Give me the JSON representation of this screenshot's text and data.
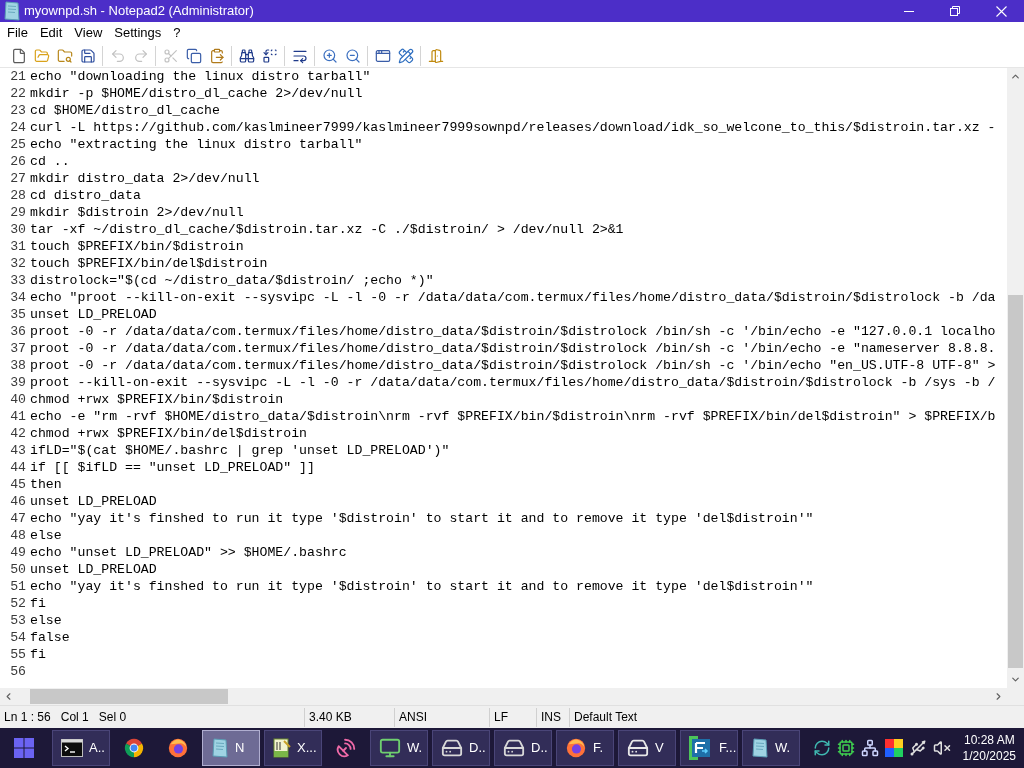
{
  "window": {
    "title": "myownpd.sh - Notepad2 (Administrator)"
  },
  "menu": [
    "File",
    "Edit",
    "View",
    "Settings",
    "?"
  ],
  "toolbar": [
    [
      {
        "disabled": false
      },
      {
        "disabled": false
      },
      {
        "disabled": false
      },
      {
        "disabled": false
      }
    ],
    [
      {
        "disabled": true
      },
      {
        "disabled": true
      }
    ],
    [
      {
        "disabled": true
      },
      {
        "disabled": false
      },
      {
        "disabled": false
      }
    ],
    [
      {
        "disabled": false
      },
      {
        "disabled": false
      }
    ],
    [
      {
        "disabled": false
      }
    ],
    [
      {
        "disabled": false
      },
      {
        "disabled": false
      }
    ],
    [
      {
        "disabled": false
      },
      {
        "disabled": false
      }
    ],
    [
      {
        "disabled": false
      }
    ]
  ],
  "editor": {
    "lines": [
      {
        "number": "21",
        "text": "echo \"downloading the linux distro tarball\""
      },
      {
        "number": "22",
        "text": "mkdir -p $HOME/distro_dl_cache 2>/dev/null"
      },
      {
        "number": "23",
        "text": "cd $HOME/distro_dl_cache"
      },
      {
        "number": "24",
        "text": "curl -L https://github.com/kaslmineer7999/kaslmineer7999sownpd/releases/download/idk_so_welcone_to_this/$distroin.tar.xz -"
      },
      {
        "number": "25",
        "text": "echo \"extracting the linux distro tarball\""
      },
      {
        "number": "26",
        "text": "cd .."
      },
      {
        "number": "27",
        "text": "mkdir distro_data 2>/dev/null"
      },
      {
        "number": "28",
        "text": "cd distro_data"
      },
      {
        "number": "29",
        "text": "mkdir $distroin 2>/dev/null"
      },
      {
        "number": "30",
        "text": "tar -xf ~/distro_dl_cache/$distroin.tar.xz -C ./$distroin/ > /dev/null 2>&1"
      },
      {
        "number": "31",
        "text": "touch $PREFIX/bin/$distroin"
      },
      {
        "number": "32",
        "text": "touch $PREFIX/bin/del$distroin"
      },
      {
        "number": "33",
        "text": "distrolock=\"$(cd ~/distro_data/$distroin/ ;echo *)\""
      },
      {
        "number": "34",
        "text": "echo \"proot --kill-on-exit --sysvipc -L -l -0 -r /data/data/com.termux/files/home/distro_data/$distroin/$distrolock -b /da"
      },
      {
        "number": "35",
        "text": "unset LD_PRELOAD"
      },
      {
        "number": "36",
        "text": "proot -0 -r /data/data/com.termux/files/home/distro_data/$distroin/$distrolock /bin/sh -c '/bin/echo -e \"127.0.0.1 localho"
      },
      {
        "number": "37",
        "text": "proot -0 -r /data/data/com.termux/files/home/distro_data/$distroin/$distrolock /bin/sh -c '/bin/echo -e \"nameserver 8.8.8."
      },
      {
        "number": "38",
        "text": "proot -0 -r /data/data/com.termux/files/home/distro_data/$distroin/$distrolock /bin/sh -c '/bin/echo \"en_US.UTF-8 UTF-8\" >"
      },
      {
        "number": "39",
        "text": "proot --kill-on-exit --sysvipc -L -l -0 -r /data/data/com.termux/files/home/distro_data/$distroin/$distrolock -b /sys -b /"
      },
      {
        "number": "40",
        "text": "chmod +rwx $PREFIX/bin/$distroin"
      },
      {
        "number": "41",
        "text": "echo -e \"rm -rvf $HOME/distro_data/$distroin\\nrm -rvf $PREFIX/bin/$distroin\\nrm -rvf $PREFIX/bin/del$distroin\" > $PREFIX/b"
      },
      {
        "number": "42",
        "text": "chmod +rwx $PREFIX/bin/del$distroin"
      },
      {
        "number": "43",
        "text": "ifLD=\"$(cat $HOME/.bashrc | grep 'unset LD_PRELOAD')\""
      },
      {
        "number": "44",
        "text": "if [[ $ifLD == \"unset LD_PRELOAD\" ]]"
      },
      {
        "number": "45",
        "text": "then"
      },
      {
        "number": "46",
        "text": "unset LD_PRELOAD"
      },
      {
        "number": "47",
        "text": "echo \"yay it's finshed to run it type '$distroin' to start it and to remove it type 'del$distroin'\""
      },
      {
        "number": "48",
        "text": "else"
      },
      {
        "number": "49",
        "text": "echo \"unset LD_PRELOAD\" >> $HOME/.bashrc"
      },
      {
        "number": "50",
        "text": "unset LD_PRELOAD"
      },
      {
        "number": "51",
        "text": "echo \"yay it's finshed to run it type '$distroin' to start it and to remove it type 'del$distroin'\""
      },
      {
        "number": "52",
        "text": "fi"
      },
      {
        "number": "53",
        "text": "else"
      },
      {
        "number": "54",
        "text": "false"
      },
      {
        "number": "55",
        "text": "fi"
      },
      {
        "number": "56"
      }
    ]
  },
  "status_bar": {
    "panes": [
      {
        "texts": [
          "Ln 1 : 56",
          "Col 1",
          "Sel 0"
        ]
      },
      {
        "texts": [
          "3.40 KB"
        ]
      },
      {
        "texts": [
          "ANSI"
        ]
      },
      {
        "texts": [
          "LF"
        ]
      },
      {
        "texts": [
          "INS"
        ]
      },
      {
        "texts": [
          "Default Text"
        ]
      }
    ]
  },
  "taskbar": {
    "items": [
      {
        "kind": "start"
      },
      {
        "kind": "task",
        "label": "A..",
        "selected": false
      },
      {
        "kind": "pinned"
      },
      {
        "kind": "pinned"
      },
      {
        "kind": "task",
        "label": "N",
        "selected": true
      },
      {
        "kind": "task",
        "label": "X...",
        "selected": false
      },
      {
        "kind": "pinned"
      },
      {
        "kind": "task",
        "label": "W.",
        "selected": false
      },
      {
        "kind": "task",
        "label": "D..",
        "selected": false
      },
      {
        "kind": "task",
        "label": "D..",
        "selected": false
      },
      {
        "kind": "task",
        "label": "F.",
        "selected": false
      },
      {
        "kind": "task",
        "label": "V",
        "selected": false
      },
      {
        "kind": "task",
        "label": "F...",
        "selected": false
      },
      {
        "kind": "task",
        "label": "W.",
        "selected": false
      }
    ],
    "clock": {
      "time": "10:28 AM",
      "date": "1/20/2025"
    }
  }
}
